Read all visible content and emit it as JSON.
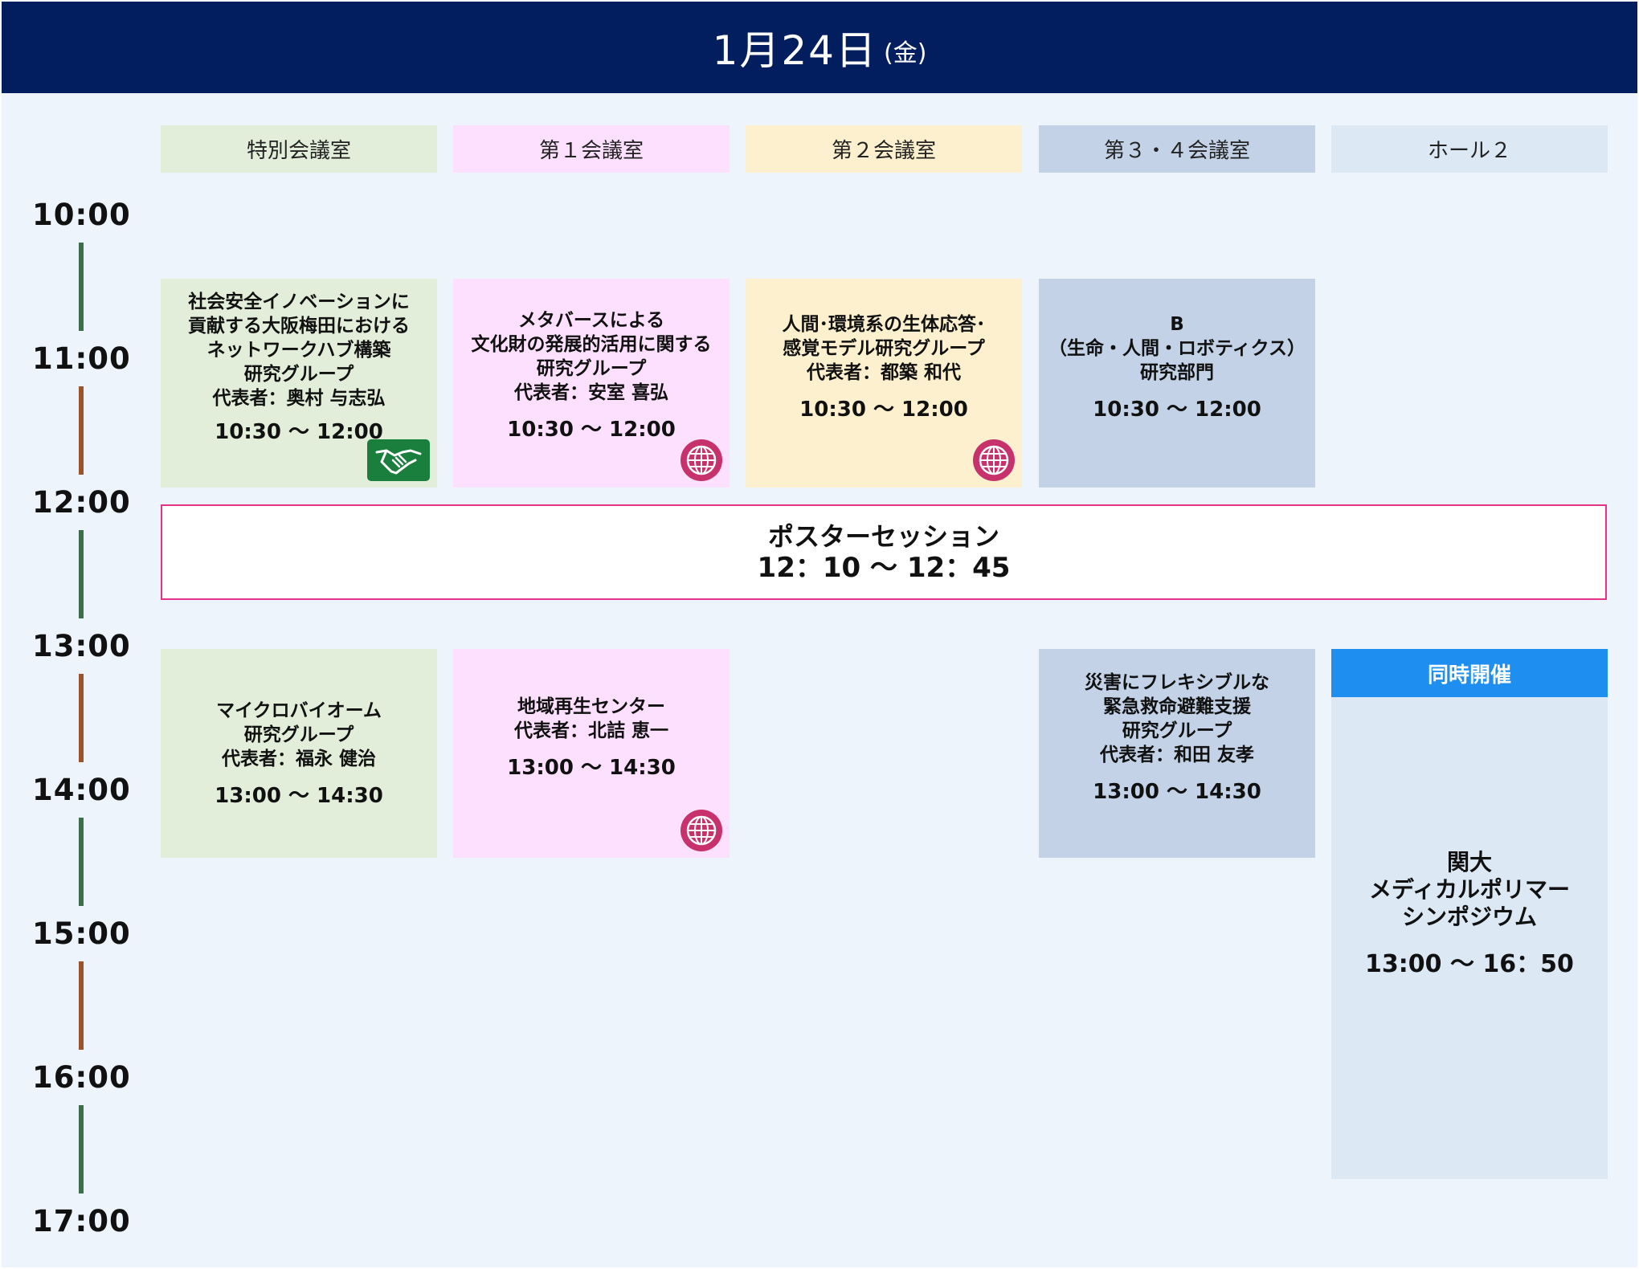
{
  "header": {
    "date": "1月24日",
    "dow": "(金)"
  },
  "rooms": [
    "特別会議室",
    "第１会議室",
    "第２会議室",
    "第３・４会議室",
    "ホール２"
  ],
  "times": [
    "10:00",
    "11:00",
    "12:00",
    "13:00",
    "14:00",
    "15:00",
    "16:00",
    "17:00"
  ],
  "colors": {
    "header": "#021e5e",
    "panel": "#eef4fc",
    "green": "#e2edda",
    "pink": "#fde0fd",
    "yellow": "#fdf0ce",
    "blue": "#c3d2e6",
    "lightblue": "#dce8f4",
    "tick_green": "#3c6e4c",
    "tick_brown": "#9c522a",
    "accent_pink": "#e4338a",
    "accent_blue": "#1e8ef0"
  },
  "events": {
    "e1": {
      "lines": [
        "社会安全イノベーションに",
        "貢献する大阪梅田における",
        "ネットワークハブ構築",
        "研究グループ",
        "代表者：奥村 与志弘"
      ],
      "time": "10:30 ～ 12:00",
      "icon": "handshake-icon"
    },
    "e2": {
      "lines": [
        "メタバースによる",
        "文化財の発展的活用に関する",
        "研究グループ",
        "代表者：安室 喜弘"
      ],
      "time": "10:30 ～ 12:00",
      "icon": "globe-icon"
    },
    "e3": {
      "lines": [
        "人間･環境系の生体応答･",
        "感覚モデル研究グループ",
        "代表者：都築 和代"
      ],
      "time": "10:30 ～ 12:00",
      "icon": "globe-icon"
    },
    "e4": {
      "lines": [
        "B",
        "（生命・人間・ロボティクス）",
        "研究部門"
      ],
      "time": "10:30 ～ 12:00"
    },
    "poster": {
      "title": "ポスターセッション",
      "time": "12：10 ～ 12：45"
    },
    "e5": {
      "lines": [
        "マイクロバイオーム",
        "研究グループ",
        "代表者：福永 健治"
      ],
      "time": "13:00 ～ 14:30"
    },
    "e6": {
      "lines": [
        "地域再生センター",
        "代表者：北詰 恵一"
      ],
      "time": "13:00 ～ 14:30",
      "icon": "globe-icon"
    },
    "e7": {
      "lines": [
        "災害にフレキシブルな",
        "緊急救命避難支援",
        "研究グループ",
        "代表者：和田 友孝"
      ],
      "time": "13:00 ～ 14:30"
    },
    "e8": {
      "badge": "同時開催",
      "lines": [
        "関大",
        "メディカルポリマー",
        "シンポジウム"
      ],
      "time": "13:00 ～ 16：50"
    }
  }
}
